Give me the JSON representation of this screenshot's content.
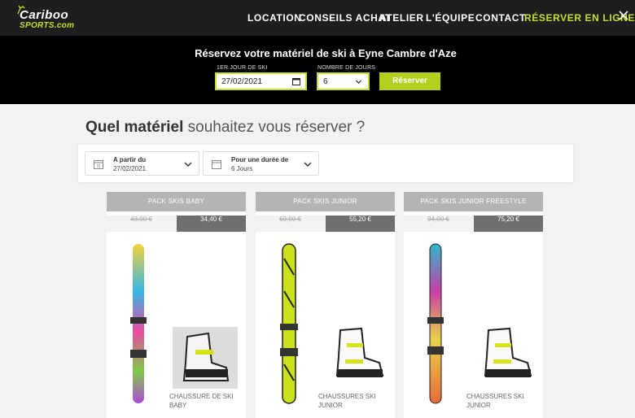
{
  "nav": {
    "logo_line1": "Cariboo",
    "logo_line2": "SPORTS.com",
    "items": [
      "LOCATION",
      "CONSEILS ACHAT",
      "ATELIER",
      "L'ÉQUIPE",
      "CONTACT",
      "RÉSERVER EN LIGNE"
    ]
  },
  "booking": {
    "title": "Réservez votre matériel de ski à Eyne Cambre d'Aze",
    "date_label": "1ER JOUR DE SKI",
    "date_value": "27/02/2021",
    "days_label": "NOMBRE DE JOURS",
    "days_value": "6",
    "submit_label": "Réserver"
  },
  "main": {
    "heading_bold": "Quel matériel",
    "heading_rest": " souhaitez vous réserver ?",
    "filters": [
      {
        "title": "A partir du",
        "value": "27/02/2021"
      },
      {
        "title": "Pour une durée de",
        "value": "6 Jours"
      }
    ],
    "packs": [
      {
        "name": "PACK SKIS BABY",
        "old_price": "43,00 €",
        "price": "34,40 €",
        "boot_label": "CHAUSSURE DE SKI BABY"
      },
      {
        "name": "PACK SKIS JUNIOR",
        "old_price": "69,00 €",
        "price": "55,20 €",
        "boot_label": "CHAUSSURES SKI JUNIOR"
      },
      {
        "name": "PACK SKIS JUNIOR FREESTYLE",
        "old_price": "94,00 €",
        "price": "75,20 €",
        "boot_label": "CHAUSSURES SKI JUNIOR"
      }
    ]
  },
  "colors": {
    "accent": "#c5e024",
    "dark": "#1e1e1e",
    "card_head": "#b4b4b4",
    "price_bg": "#6f6f6f"
  }
}
